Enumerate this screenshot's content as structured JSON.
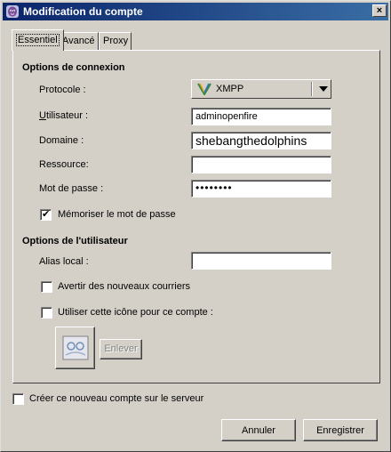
{
  "window": {
    "title": "Modification du compte",
    "close_glyph": "×"
  },
  "tabs": [
    {
      "label": "Essentiel",
      "active": true
    },
    {
      "label": "Avancé",
      "active": false
    },
    {
      "label": "Proxy",
      "active": false
    }
  ],
  "connection": {
    "section_title": "Options de connexion",
    "protocol_label": "Protocole :",
    "protocol_value": "XMPP",
    "username_label": "Utilisateur :",
    "username_value": "adminopenfire",
    "domain_label": "Domaine :",
    "domain_value": "shebangthedolphins",
    "resource_label": "Ressource:",
    "resource_value": "",
    "password_label": "Mot de passe :",
    "password_value": "••••••••",
    "remember_password_label": "Mémoriser le mot de passe",
    "remember_password_checked": true
  },
  "user_options": {
    "section_title": "Options de l'utilisateur",
    "local_alias_label": "Alias local :",
    "local_alias_value": "",
    "new_mail_label": "Avertir des nouveaux courriers",
    "new_mail_checked": false,
    "use_icon_label": "Utiliser cette icône pour ce compte :",
    "use_icon_checked": false,
    "remove_button_label": "Enlever"
  },
  "create_account_label": "Créer ce nouveau compte sur le serveur",
  "create_account_checked": false,
  "buttons": {
    "cancel": "Annuler",
    "save": "Enregistrer"
  },
  "colors": {
    "titlebar": "#0a246a",
    "window_bg": "#d4d0c8"
  }
}
